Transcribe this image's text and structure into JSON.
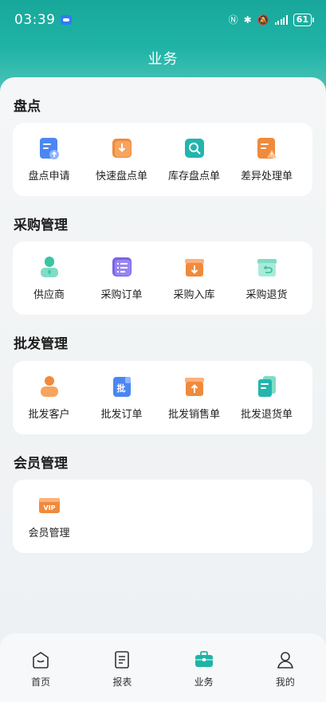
{
  "status": {
    "time": "03:39",
    "battery": "61"
  },
  "header": {
    "title": "业务"
  },
  "sections": [
    {
      "title": "盘点",
      "items": [
        {
          "label": "盘点申请",
          "icon": "upload-doc-icon",
          "color": "#4b86f2"
        },
        {
          "label": "快速盘点单",
          "icon": "arrow-down-doc-icon",
          "color": "#f08a3c"
        },
        {
          "label": "库存盘点单",
          "icon": "search-doc-icon",
          "color": "#23b5ad"
        },
        {
          "label": "差异处理单",
          "icon": "warning-doc-icon",
          "color": "#f08a3c"
        }
      ]
    },
    {
      "title": "采购管理",
      "items": [
        {
          "label": "供应商",
          "icon": "supplier-icon",
          "color": "#3cc3a2"
        },
        {
          "label": "采购订单",
          "icon": "list-icon",
          "color": "#7a63e8"
        },
        {
          "label": "采购入库",
          "icon": "box-in-icon",
          "color": "#f08a3c"
        },
        {
          "label": "采购退货",
          "icon": "box-return-icon",
          "color": "#3cc3a2"
        }
      ]
    },
    {
      "title": "批发管理",
      "items": [
        {
          "label": "批发客户",
          "icon": "customer-icon",
          "color": "#f08a3c"
        },
        {
          "label": "批发订单",
          "icon": "wholesale-order-icon",
          "color": "#4b86f2",
          "glyph": "批"
        },
        {
          "label": "批发销售单",
          "icon": "box-up-icon",
          "color": "#f08a3c"
        },
        {
          "label": "批发退货单",
          "icon": "cards-icon",
          "color": "#23b5ad"
        }
      ]
    },
    {
      "title": "会员管理",
      "items": [
        {
          "label": "会员管理",
          "icon": "vip-card-icon",
          "color": "#f08a3c",
          "glyph": "VIP"
        }
      ]
    }
  ],
  "tabbar": [
    {
      "label": "首页",
      "icon": "home-icon",
      "active": false
    },
    {
      "label": "报表",
      "icon": "report-icon",
      "active": false
    },
    {
      "label": "业务",
      "icon": "briefcase-icon",
      "active": true
    },
    {
      "label": "我的",
      "icon": "profile-icon",
      "active": false
    }
  ],
  "colors": {
    "brand": "#1fb3a6",
    "orange": "#f08a3c",
    "blue": "#4b86f2",
    "purple": "#7a63e8",
    "green": "#3cc3a2"
  }
}
